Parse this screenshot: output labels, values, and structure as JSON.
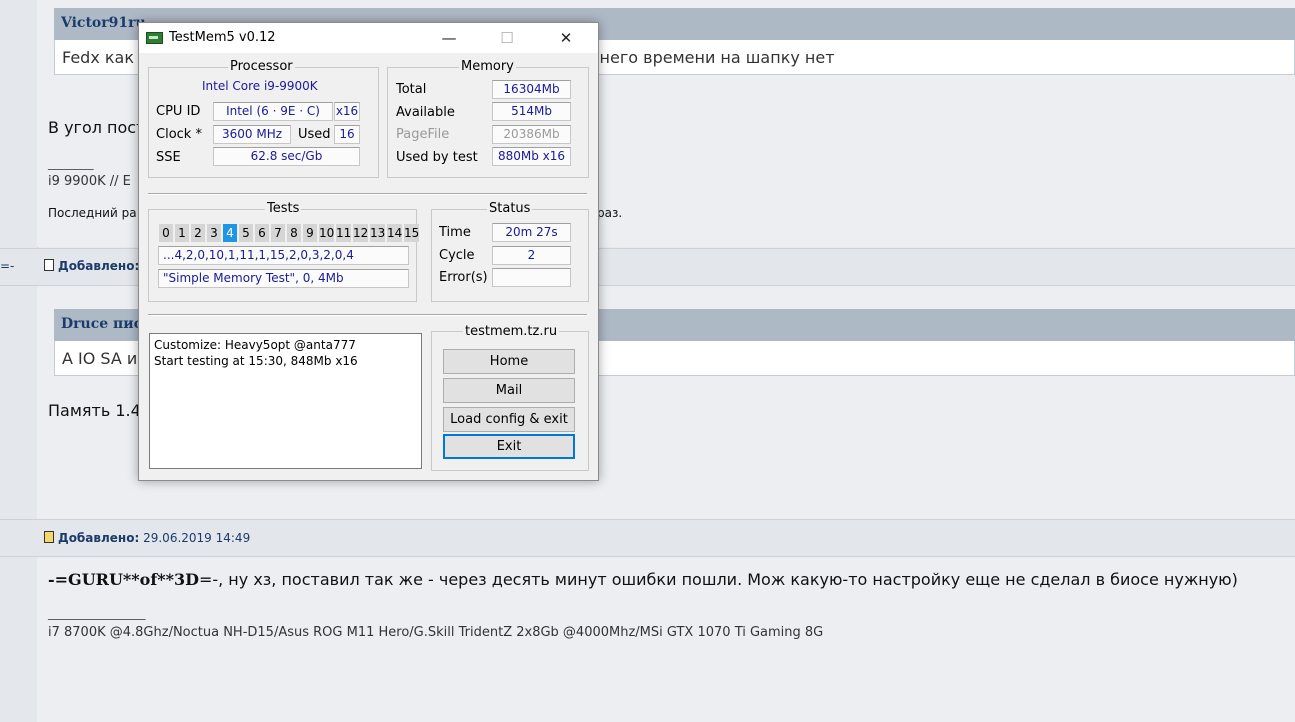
{
  "forum": {
    "quote1": {
      "author": "Victor91ru",
      "text": "Fedx как",
      "text_right": "у него времени на шапку нет"
    },
    "post1": {
      "line1": "В угол пост",
      "sig_dash": "_______",
      "sig": "i9 9900K // E",
      "last_edit_left": "Последний ра",
      "last_edit_right": "раз."
    },
    "row2": {
      "left": "=-",
      "label": "Добавлено:"
    },
    "quote2": {
      "author": "Druce пис",
      "text": "А IO SA и"
    },
    "post2": {
      "line1": "Память 1.4"
    },
    "row3": {
      "label": "Добавлено:",
      "date": "29.06.2019 14:49"
    },
    "post3": {
      "bold": "-=GURU**of**3D",
      "rest": "=-, ну хз, поставил так же - через десять минут ошибки пошли. Мож какую-то настройку еще не сделал в биосе нужную)",
      "sig_dash": "_______________",
      "sig": "i7 8700K @4.8Ghz/Noctua NH-D15/Asus ROG M11 Hero/G.Skill TridentZ 2x8Gb @4000Mhz/MSi GTX 1070 Ti Gaming 8G"
    }
  },
  "window": {
    "title": "TestMem5 v0.12",
    "controls": {
      "minimize": "—",
      "maximize": "☐",
      "close": "✕"
    },
    "processor": {
      "label": "Processor",
      "name": "Intel Core i9-9900K",
      "cpu_id_label": "CPU ID",
      "cpu_id": "Intel  (6 · 9E · C)",
      "threads": "x16",
      "clock_label": "Clock *",
      "clock": "3600 MHz",
      "used_label": "Used",
      "used": "16",
      "sse_label": "SSE",
      "sse": "62.8 sec/Gb"
    },
    "memory": {
      "label": "Memory",
      "total_label": "Total",
      "total": "16304Mb",
      "available_label": "Available",
      "available": "514Mb",
      "pagefile_label": "PageFile",
      "pagefile": "20386Mb",
      "used_label": "Used by test",
      "used": "880Mb x16"
    },
    "tests": {
      "label": "Tests",
      "cells": [
        "0",
        "1",
        "2",
        "3",
        "4",
        "5",
        "6",
        "7",
        "8",
        "9",
        "10",
        "11",
        "12",
        "13",
        "14",
        "15"
      ],
      "active_index": 4,
      "sequence": "...4,2,0,10,1,11,1,15,2,0,3,2,0,4",
      "current": "\"Simple Memory Test\", 0, 4Mb"
    },
    "status": {
      "label": "Status",
      "time_label": "Time",
      "time": "20m 27s",
      "cycle_label": "Cycle",
      "cycle": "2",
      "errors_label": "Error(s)",
      "errors": ""
    },
    "log": [
      "Customize: Heavy5opt @anta777",
      "Start testing at 15:30, 848Mb x16"
    ],
    "links": {
      "label": "testmem.tz.ru",
      "home": "Home",
      "mail": "Mail",
      "load": "Load config & exit",
      "exit": "Exit"
    }
  }
}
